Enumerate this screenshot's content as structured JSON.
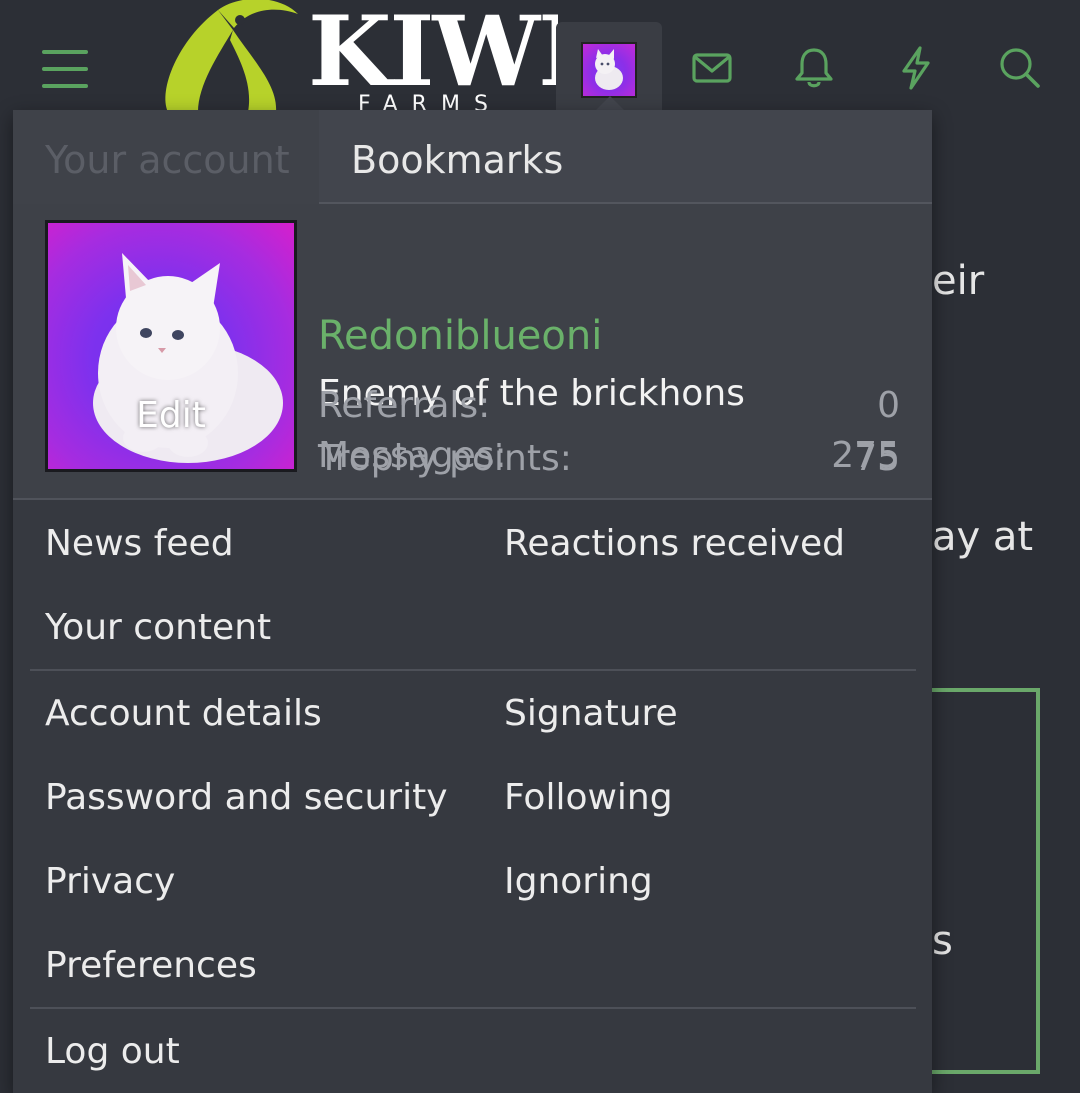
{
  "header": {
    "logo_wordmark": "KIWI",
    "logo_subtitle": "FARMS",
    "icons": [
      "hamburger-icon",
      "avatar",
      "mail-icon",
      "bell-icon",
      "lightning-icon",
      "search-icon"
    ]
  },
  "background_page": {
    "fragments": [
      "eir",
      "ay at",
      "s"
    ]
  },
  "menu": {
    "tabs": {
      "account": "Your account",
      "bookmarks": "Bookmarks"
    },
    "profile": {
      "avatar_edit": "Edit",
      "username": "Redoniblueoni",
      "user_title": "Enemy of the brickhons",
      "stats": [
        {
          "label": "Messages:",
          "value": "275"
        },
        {
          "label": "Referrals:",
          "value": "0"
        },
        {
          "label": "Trophy points:",
          "value": "75"
        }
      ]
    },
    "links": {
      "news_feed": "News feed",
      "reactions_received": "Reactions received",
      "your_content": "Your content",
      "account_details": "Account details",
      "signature": "Signature",
      "password_security": "Password and security",
      "following": "Following",
      "privacy": "Privacy",
      "ignoring": "Ignoring",
      "preferences": "Preferences",
      "log_out": "Log out"
    }
  },
  "colors": {
    "background": "#2c2f36",
    "menu": "#363940",
    "accent_green": "#6ab16a",
    "logo_lime": "#b7d22a"
  }
}
